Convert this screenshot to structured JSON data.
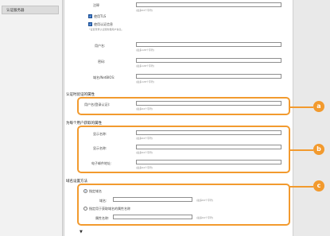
{
  "sidebar": {
    "item": "认证服务器"
  },
  "fields": {
    "annotation": {
      "label": "注释",
      "hint": "(最多64个字符)"
    },
    "use_tls": {
      "label": "使用TLS",
      "checked": true
    },
    "use_auth": {
      "label": "使用认证信息",
      "checked": true,
      "hint": "*设置登录认证服务器用户信息。"
    },
    "username": {
      "label": "用户名:",
      "hint": "(最多128个字符)"
    },
    "password": {
      "label": "密码:",
      "hint": "(最多128个字符)"
    },
    "domain": {
      "label": "域名/NetBIOS:",
      "hint": "(最多128个字符)"
    }
  },
  "section_login": {
    "title": "认证时验证的属性",
    "field_label": "用户名(登录认证):",
    "hint": "(最多64个字符)"
  },
  "section_attrs": {
    "title": "为每个用户获取的属性",
    "fields": [
      {
        "label": "显示名称:",
        "hint": "(最多64个字符)"
      },
      {
        "label": "显示名称:",
        "hint": "(最多64个字符)"
      },
      {
        "label": "电子邮件地址:",
        "hint": "(最多64个字符)"
      }
    ]
  },
  "section_domain": {
    "title": "域名设置方法",
    "option_specify": {
      "label": "指定域名",
      "selected": true
    },
    "domain_label": "域名:",
    "domain_hint": "(最多64个字符)",
    "option_attr": {
      "label": "指定用于获取域名的属性名称",
      "selected": false
    },
    "attr_label": "属性名称:",
    "attr_hint": "(最多64个字符)"
  },
  "callouts": [
    "a",
    "b",
    "c"
  ],
  "scroll_icon": "chevron-down-icon",
  "colors": {
    "callout": "#f29a2e",
    "checkbox": "#2d6cc0"
  }
}
